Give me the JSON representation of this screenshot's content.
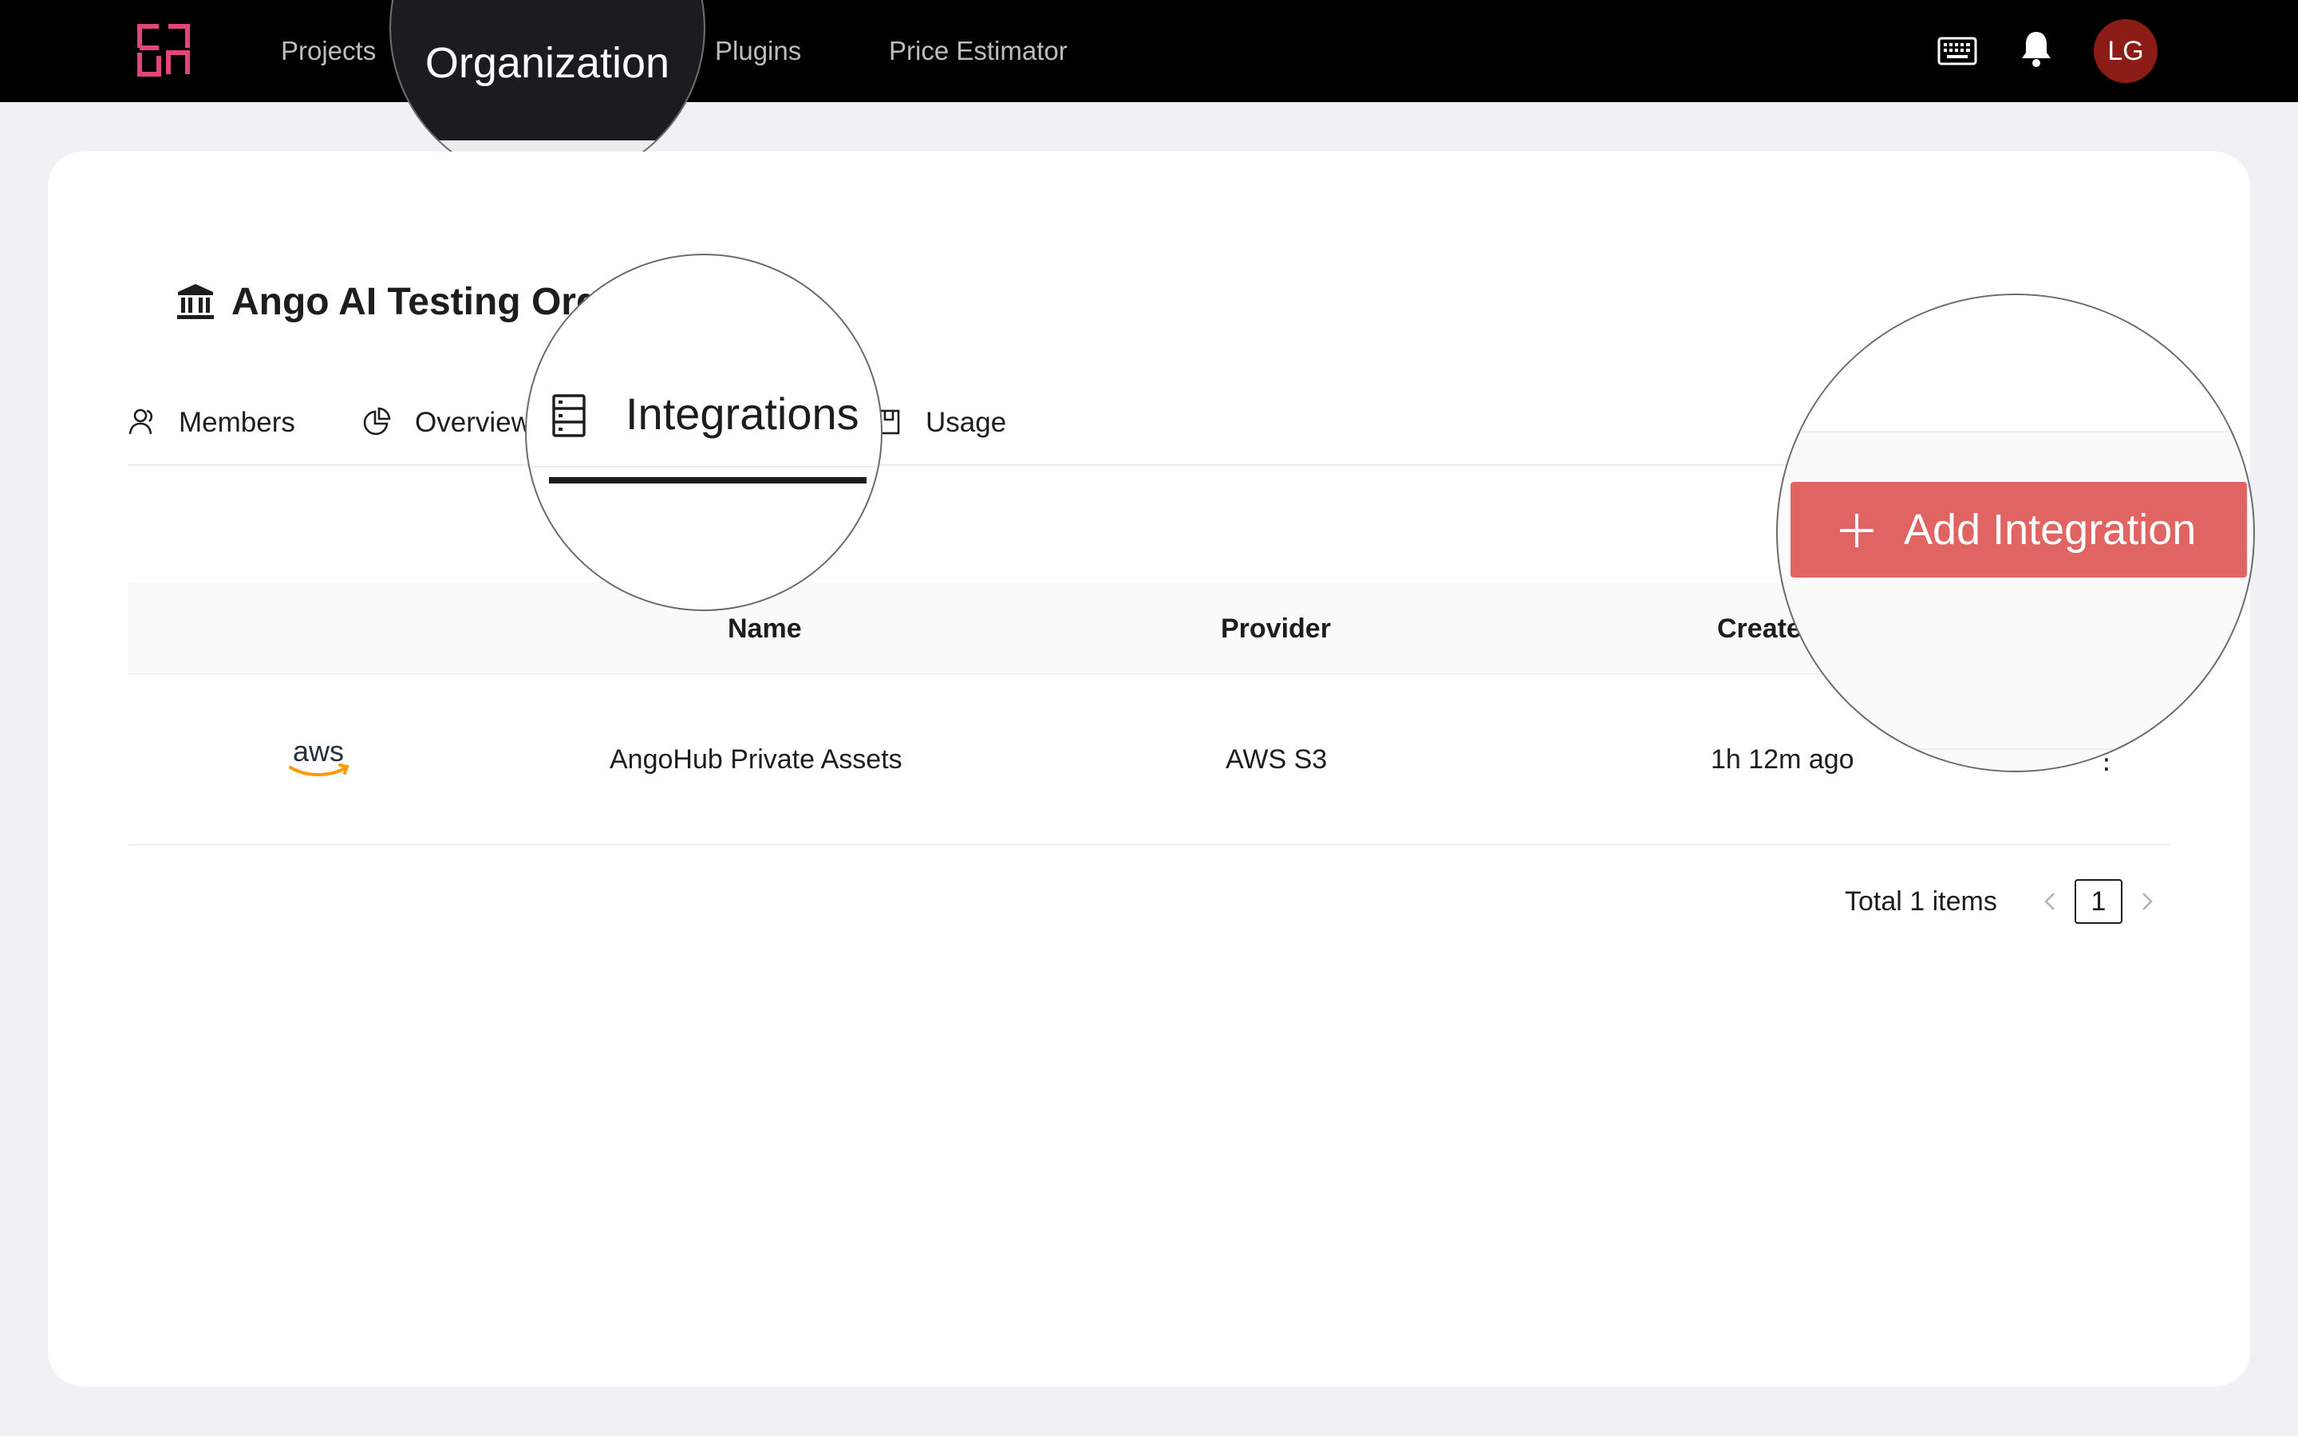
{
  "topbar": {
    "nav": {
      "projects": "Projects",
      "organization": "Organization",
      "plugins": "Plugins",
      "price_estimator": "Price Estimator"
    },
    "avatar_initials": "LG",
    "icons": {
      "logo": "ango-logo",
      "keyboard": "keyboard-icon",
      "bell": "bell-icon"
    }
  },
  "organization": {
    "title": "Ango AI Testing Org",
    "icon": "bank-icon"
  },
  "tabs": {
    "members": "Members",
    "overview": "Overview",
    "integrations": "Integrations",
    "usage": "Usage",
    "active": "Integrations"
  },
  "actions": {
    "add_integration": "Add Integration"
  },
  "table": {
    "columns": {
      "name": "Name",
      "provider": "Provider",
      "created": "Created"
    },
    "rows": [
      {
        "logo": "aws",
        "name": "AngoHub Private Assets",
        "provider": "AWS S3",
        "created": "1h 12m ago",
        "more": "⋮"
      }
    ]
  },
  "pagination": {
    "total": "Total 1 items",
    "current_page": "1"
  },
  "colors": {
    "topbar": "#000000",
    "accent_logo": "#e0457b",
    "primary_button": "#e06461",
    "avatar": "#8b1c16",
    "aws_smile": "#f90"
  }
}
